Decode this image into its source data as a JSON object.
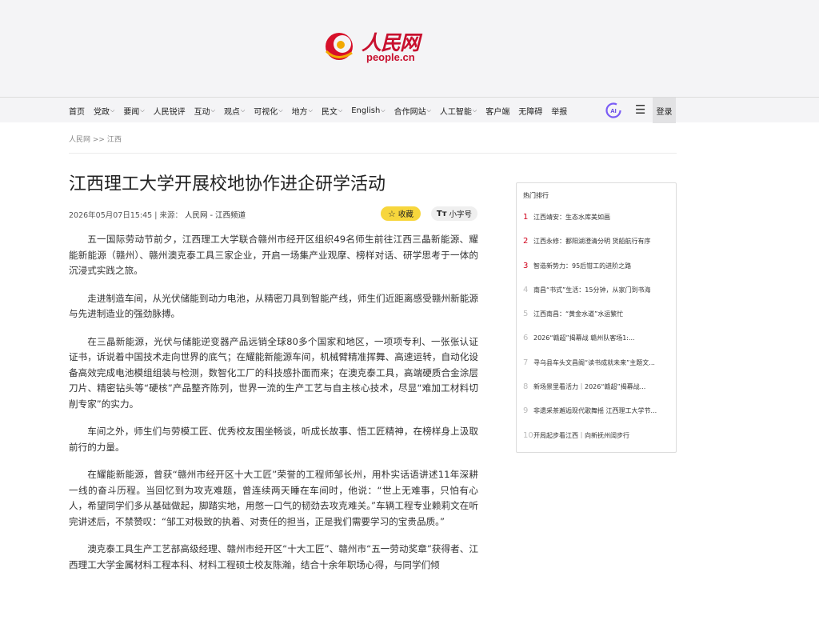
{
  "logo": {
    "cn": "人民网",
    "en": "people.cn"
  },
  "nav": {
    "items": [
      {
        "label": "首页",
        "dropdown": false
      },
      {
        "label": "党政",
        "dropdown": true
      },
      {
        "label": "要闻",
        "dropdown": true
      },
      {
        "label": "人民锐评",
        "dropdown": false
      },
      {
        "label": "互动",
        "dropdown": true
      },
      {
        "label": "观点",
        "dropdown": true
      },
      {
        "label": "可视化",
        "dropdown": true
      },
      {
        "label": "地方",
        "dropdown": true
      },
      {
        "label": "民文",
        "dropdown": true
      },
      {
        "label": "English",
        "dropdown": true
      },
      {
        "label": "合作网站",
        "dropdown": true
      },
      {
        "label": "人工智能",
        "dropdown": true
      },
      {
        "label": "客户端",
        "dropdown": false
      },
      {
        "label": "无障碍",
        "dropdown": false
      },
      {
        "label": "举报",
        "dropdown": false
      }
    ],
    "ai_label": "AI",
    "menu_icon": "☰",
    "login": "登录",
    "chevron": "⌵"
  },
  "breadcrumb": {
    "home": "人民网",
    "sep": ">>",
    "section": "江西"
  },
  "article": {
    "title": "江西理工大学开展校地协作进企研学活动",
    "datetime": "2026年05月07日15:45",
    "source_sep": "|",
    "source_label": "来源：",
    "source": "人民网 - 江西频道",
    "favorite_label": "收藏",
    "font_label": "小字号",
    "font_icon": "Tт",
    "paragraphs": [
      "五一国际劳动节前夕，江西理工大学联合赣州市经开区组织49名师生前往江西三晶新能源、耀能新能源（赣州）、赣州澳克泰工具三家企业，开启一场集产业观摩、榜样对话、研学思考于一体的沉浸式实践之旅。",
      "走进制造车间，从光伏储能到动力电池，从精密刀具到智能产线，师生们近距离感受赣州新能源与先进制造业的强劲脉搏。",
      "在三晶新能源，光伏与储能逆变器产品远销全球80多个国家和地区，一项项专利、一张张认证证书，诉说着中国技术走向世界的底气；在耀能新能源车间，机械臂精准挥舞、高速运转，自动化设备高效完成电池模组组装与检测，数智化工厂的科技感扑面而来；在澳克泰工具，高端硬质合金涂层刀片、精密钻头等“硬核”产品整齐陈列，世界一流的生产工艺与自主核心技术，尽显“难加工材料切削专家”的实力。",
      "车间之外，师生们与劳模工匠、优秀校友围坐畅谈，听成长故事、悟工匠精神，在榜样身上汲取前行的力量。",
      "在耀能新能源，曾获“赣州市经开区十大工匠”荣誉的工程师邹长州，用朴实话语讲述11年深耕一线的奋斗历程。当回忆到为攻克难题，曾连续两天睡在车间时，他说：“世上无难事，只怕有心人，希望同学们多从基础做起，脚踏实地，用憋一口气的韧劲去攻克难关。”车辆工程专业赖莉文在听完讲述后，不禁赞叹：“邹工对极致的执着、对责任的担当，正是我们需要学习的宝贵品质。”",
      "澳克泰工具生产工艺部高级经理、赣州市经开区“十大工匠”、赣州市“五一劳动奖章”获得者、江西理工大学金属材料工程本科、材料工程硕士校友陈瀚，结合十余年职场心得，与同学们倾"
    ]
  },
  "sidebar": {
    "title": "热门排行",
    "items": [
      {
        "num": "1",
        "text": "江西靖安：生态水库美如画"
      },
      {
        "num": "2",
        "text": "江西永修：鄱阳湖澄清分明 货船航行有序"
      },
      {
        "num": "3",
        "text": "智造新势力：95后钳工的进阶之路"
      },
      {
        "num": "4",
        "text": "南昌“书式”生活：15分钟，从家门到书海"
      },
      {
        "num": "5",
        "text": "江西南昌：“黄金水道”水运繁忙"
      },
      {
        "num": "6",
        "text": "2026“赣超”揭幕战 赣州队客场1:..."
      },
      {
        "num": "7",
        "text": "寻乌县车头文昌阁“读书成就未来”主题文..."
      },
      {
        "num": "8",
        "text": "新场景里看活力｜2026“赣超”揭幕战..."
      },
      {
        "num": "9",
        "text": "非遗采茶邂逅现代歌舞摇 江西理工大学节..."
      },
      {
        "num": "10",
        "text": "开局起步看江西｜向新抚州阔步行"
      }
    ]
  }
}
